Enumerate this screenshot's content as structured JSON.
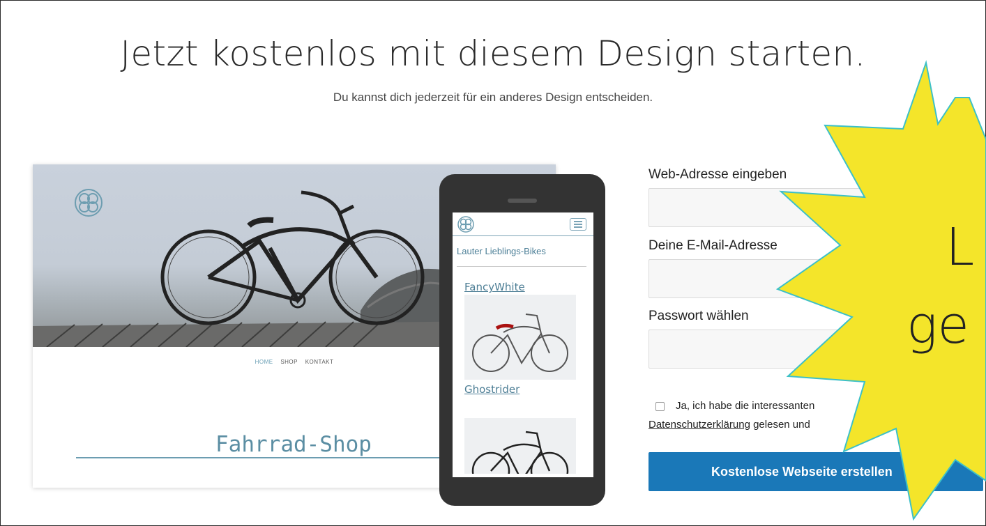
{
  "header": {
    "title": "Jetzt kostenlos mit diesem Design starten.",
    "subtitle": "Du kannst dich jederzeit für ein anderes Design entscheiden."
  },
  "desktop_preview": {
    "nav": [
      "HOME",
      "SHOP",
      "KONTAKT"
    ],
    "shop_title": "Fahrrad-Shop"
  },
  "mobile_preview": {
    "tagline": "Lauter Lieblings-Bikes",
    "items": [
      "FancyWhite",
      "Ghostrider"
    ]
  },
  "form": {
    "web_address_label": "Web-Adresse eingeben",
    "email_label": "Deine E-Mail-Adresse",
    "password_label": "Passwort wählen",
    "consent_line1": "Ja, ich habe die interessanten",
    "consent_link": "Datenschutzerklärung",
    "consent_line2_rest": " gelesen und",
    "submit_label": "Kostenlose Webseite erstellen"
  },
  "starburst": {
    "text_line1": "L",
    "text_line2": "ge",
    "color": "#f4e52a",
    "outline": "#3cc0c8"
  }
}
